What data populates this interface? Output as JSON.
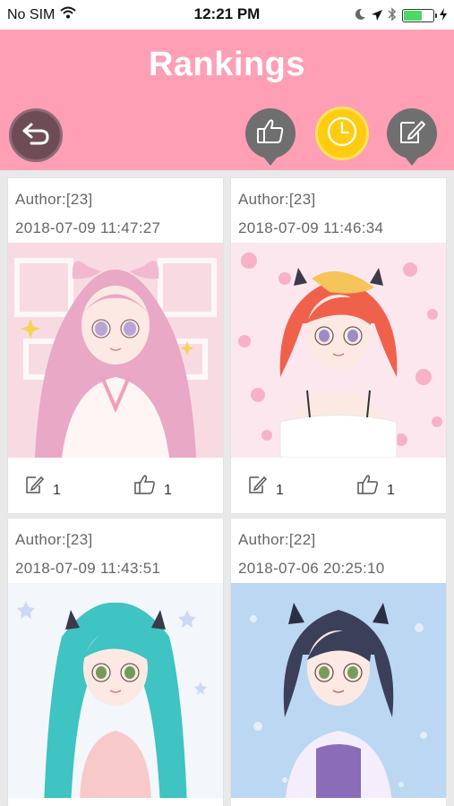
{
  "status_bar": {
    "carrier": "No SIM",
    "time": "12:21 PM",
    "battery_level": 0.6
  },
  "header": {
    "title": "Rankings",
    "buttons": {
      "back": "back-arrow-icon",
      "like": "thumbs-up-icon",
      "recent": "clock-icon",
      "comment": "edit-note-icon"
    },
    "active_tab": "recent"
  },
  "cards": [
    {
      "author": "Author:[23]",
      "date": "2018-07-09 11:47:27",
      "comments": "1",
      "likes": "1",
      "hair": "#e9a8c6",
      "bg": "#f8dbe2"
    },
    {
      "author": "Author:[23]",
      "date": "2018-07-09 11:46:34",
      "comments": "1",
      "likes": "1",
      "hair": "#f0614c",
      "bg": "#fde7ee"
    },
    {
      "author": "Author:[23]",
      "date": "2018-07-09 11:43:51",
      "comments": "",
      "likes": "",
      "hair": "#3fc3c3",
      "bg": "#f3f6fb"
    },
    {
      "author": "Author:[22]",
      "date": "2018-07-06 20:25:10",
      "comments": "",
      "likes": "",
      "hair": "#3b3f5a",
      "bg": "#bcd7f2"
    }
  ],
  "colors": {
    "header": "#fe9fb6",
    "active_button": "#ffcc11",
    "inactive_button": "#6f6f6f"
  }
}
